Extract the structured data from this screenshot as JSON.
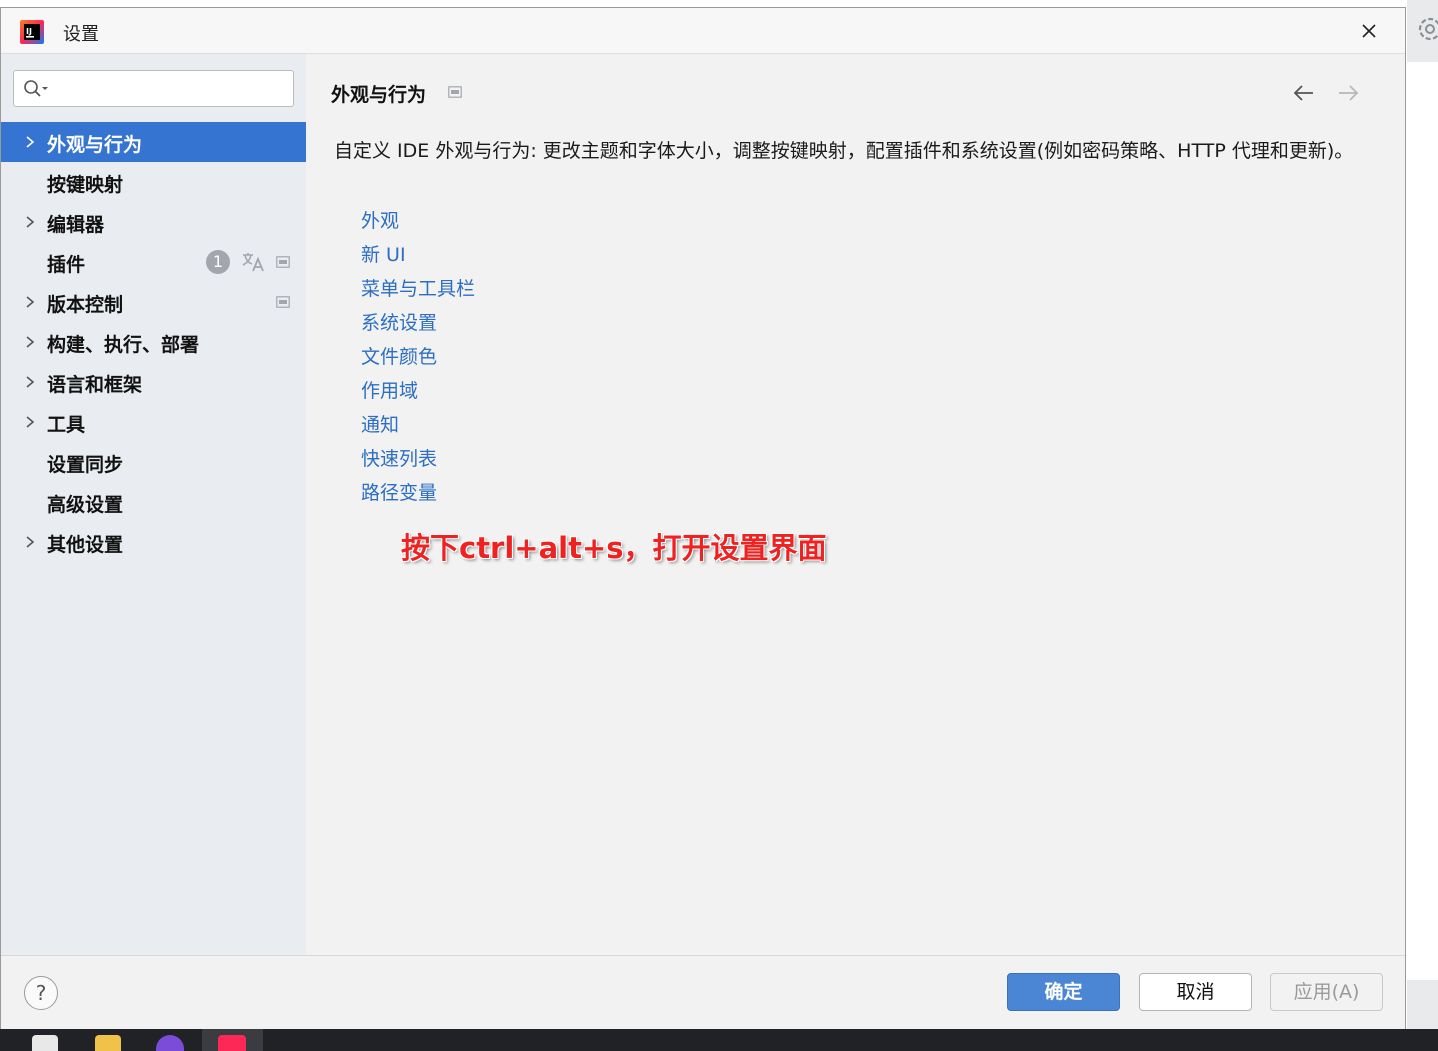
{
  "window": {
    "title": "设置"
  },
  "search": {
    "value": "",
    "placeholder": ""
  },
  "sidebar": {
    "items": [
      {
        "label": "外观与行为",
        "expandable": true,
        "selected": true
      },
      {
        "label": "按键映射",
        "expandable": false
      },
      {
        "label": "编辑器",
        "expandable": true
      },
      {
        "label": "插件",
        "expandable": false,
        "badge": "1"
      },
      {
        "label": "版本控制",
        "expandable": true
      },
      {
        "label": "构建、执行、部署",
        "expandable": true
      },
      {
        "label": "语言和框架",
        "expandable": true
      },
      {
        "label": "工具",
        "expandable": true
      },
      {
        "label": "设置同步",
        "expandable": false
      },
      {
        "label": "高级设置",
        "expandable": false
      },
      {
        "label": "其他设置",
        "expandable": true
      }
    ]
  },
  "main": {
    "title": "外观与行为",
    "description": "自定义 IDE 外观与行为: 更改主题和字体大小，调整按键映射，配置插件和系统设置(例如密码策略、HTTP 代理和更新)。",
    "links": [
      "外观",
      "新 UI",
      "菜单与工具栏",
      "系统设置",
      "文件颜色",
      "作用域",
      "通知",
      "快速列表",
      "路径变量"
    ],
    "annotation": "按下ctrl+alt+s，打开设置界面"
  },
  "footer": {
    "help_label": "?",
    "ok_label": "确定",
    "cancel_label": "取消",
    "apply_label": "应用(A)"
  },
  "colors": {
    "accent": "#3574d0",
    "link": "#2c6ec3",
    "annotation": "#ef2222"
  }
}
